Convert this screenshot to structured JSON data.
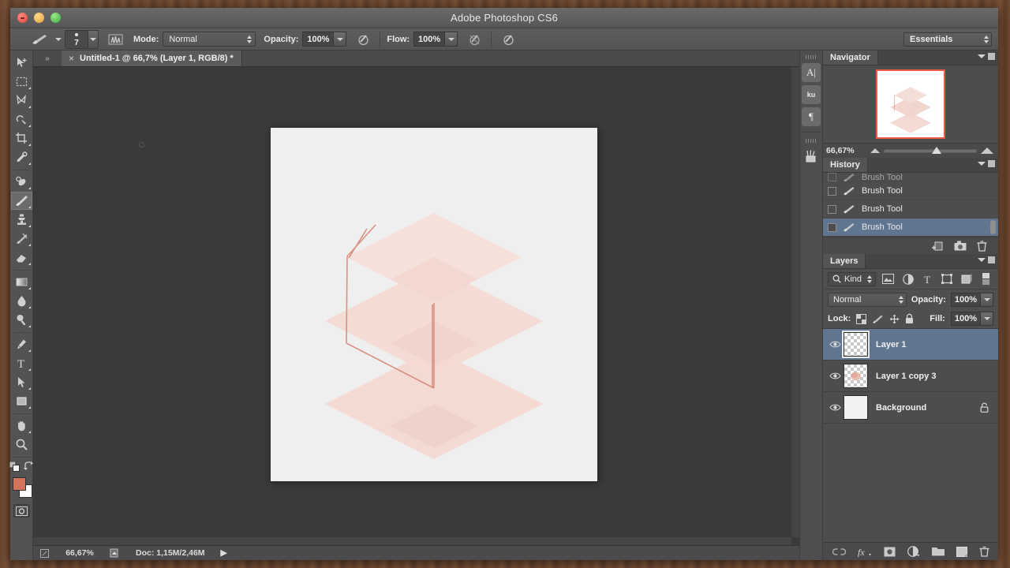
{
  "window": {
    "app_title": "Adobe Photoshop CS6",
    "traffic_lights": [
      "close-button",
      "minimize-button",
      "zoom-button"
    ]
  },
  "options_bar": {
    "brush_preset_icon": "brush-preset-icon",
    "brush_size": "7",
    "brush_panel_icon": "brush-panel-toggle-icon",
    "mode_label": "Mode:",
    "mode_value": "Normal",
    "opacity_label": "Opacity:",
    "opacity_value": "100%",
    "pressure_opacity_icon": "airbrush-pressure-opacity-icon",
    "flow_label": "Flow:",
    "flow_value": "100%",
    "airbrush_icon": "airbrush-icon",
    "pressure_size_icon": "tablet-pressure-size-icon",
    "workspace_value": "Essentials"
  },
  "toolbox": {
    "tools": [
      {
        "name": "move-tool",
        "label": "Move Tool"
      },
      {
        "name": "rectangular-marquee-tool",
        "label": "Rectangular Marquee Tool"
      },
      {
        "name": "lasso-tool",
        "label": "Lasso Tool"
      },
      {
        "name": "quick-selection-tool",
        "label": "Quick Selection Tool"
      },
      {
        "name": "crop-tool",
        "label": "Crop Tool"
      },
      {
        "name": "eyedropper-tool",
        "label": "Eyedropper Tool"
      },
      {
        "name": "spot-healing-brush-tool",
        "label": "Spot Healing Brush Tool"
      },
      {
        "name": "brush-tool",
        "label": "Brush Tool"
      },
      {
        "name": "clone-stamp-tool",
        "label": "Clone Stamp Tool"
      },
      {
        "name": "history-brush-tool",
        "label": "History Brush Tool"
      },
      {
        "name": "eraser-tool",
        "label": "Eraser Tool"
      },
      {
        "name": "gradient-tool",
        "label": "Gradient Tool"
      },
      {
        "name": "blur-tool",
        "label": "Blur Tool"
      },
      {
        "name": "dodge-tool",
        "label": "Dodge Tool"
      },
      {
        "name": "pen-tool",
        "label": "Pen Tool"
      },
      {
        "name": "horizontal-type-tool",
        "label": "Horizontal Type Tool"
      },
      {
        "name": "path-selection-tool",
        "label": "Path Selection Tool"
      },
      {
        "name": "rectangle-tool",
        "label": "Rectangle Tool"
      },
      {
        "name": "hand-tool",
        "label": "Hand Tool"
      },
      {
        "name": "zoom-tool",
        "label": "Zoom Tool"
      }
    ],
    "active_tool": "brush-tool",
    "foreground_color": "#d4735c",
    "background_color": "#ffffff",
    "quick_mask_label": "Edit in Quick Mask Mode"
  },
  "document": {
    "tab_title": "Untitled-1 @ 66,7% (Layer 1, RGB/8) *",
    "close_glyph": "×",
    "canvas_background": "#efefef",
    "artwork_name": "isometric-stacked-planes",
    "artwork_fill": "#f2d9d2",
    "artwork_line": "#d99a8c"
  },
  "status_bar": {
    "zoom": "66,67%",
    "doc_info": "Doc: 1,15M/2,46M",
    "play_glyph": "▶"
  },
  "icon_dock": {
    "items": [
      {
        "name": "character-panel-icon",
        "glyph": "A|"
      },
      {
        "name": "kuler-panel-icon",
        "glyph": "ku"
      },
      {
        "name": "paragraph-panel-icon",
        "glyph": "¶"
      },
      {
        "name": "tool-presets-panel-icon",
        "glyph": "brush-holder"
      }
    ],
    "collapse_glyph": "«"
  },
  "navigator": {
    "title": "Navigator",
    "zoom_value": "66,67%",
    "thumb_name": "navigator-thumbnail"
  },
  "history": {
    "title": "History",
    "items": [
      {
        "label": "Brush Tool",
        "selected": false,
        "partial": true
      },
      {
        "label": "Brush Tool",
        "selected": false,
        "partial": false
      },
      {
        "label": "Brush Tool",
        "selected": false,
        "partial": false
      },
      {
        "label": "Brush Tool",
        "selected": true,
        "partial": false
      }
    ],
    "footer_icons": [
      "new-document-from-state-icon",
      "new-snapshot-icon",
      "delete-state-icon"
    ]
  },
  "layers": {
    "title": "Layers",
    "filter_kind_label": "Kind",
    "filter_icons": [
      "filter-pixel-layers-icon",
      "filter-adjustment-layers-icon",
      "filter-type-layers-icon",
      "filter-shape-layers-icon",
      "filter-smart-object-icon"
    ],
    "blend_mode": "Normal",
    "opacity_label": "Opacity:",
    "opacity_value": "100%",
    "lock_label": "Lock:",
    "lock_icons": [
      "lock-transparent-pixels-icon",
      "lock-image-pixels-icon",
      "lock-position-icon",
      "lock-all-icon"
    ],
    "fill_label": "Fill:",
    "fill_value": "100%",
    "rows": [
      {
        "name": "Layer 1",
        "selected": true,
        "thumb": "transparent",
        "locked": false
      },
      {
        "name": "Layer 1 copy 3",
        "selected": false,
        "thumb": "transparent-art",
        "locked": false
      },
      {
        "name": "Background",
        "selected": false,
        "thumb": "white",
        "locked": true
      }
    ],
    "footer_icons": [
      "link-layers-icon",
      "layer-style-fx-icon",
      "add-layer-mask-icon",
      "new-adjustment-layer-icon",
      "new-group-icon",
      "new-layer-icon",
      "delete-layer-icon"
    ]
  }
}
